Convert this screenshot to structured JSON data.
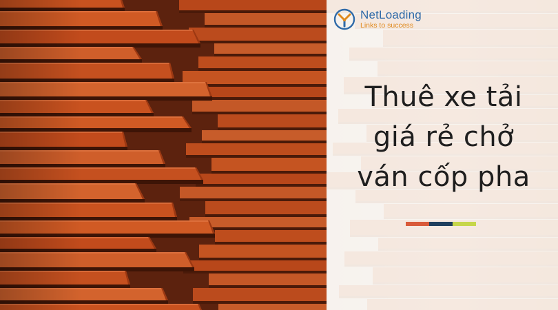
{
  "logo": {
    "name": "NetLoading",
    "tagline": "Links to success",
    "icon": "netloading-logo-icon"
  },
  "headline": {
    "lines": [
      "Thuê xe tải",
      "giá rẻ chở",
      "ván cốp pha"
    ]
  },
  "colors": {
    "board": "#c9521f",
    "board_dark": "#7a2d12",
    "text": "#1f1f1f",
    "logo_blue": "#2f6aa8",
    "logo_orange": "#e08a1e",
    "divider": [
      "#d95a3a",
      "#1f3f5e",
      "#c6d64a"
    ]
  }
}
